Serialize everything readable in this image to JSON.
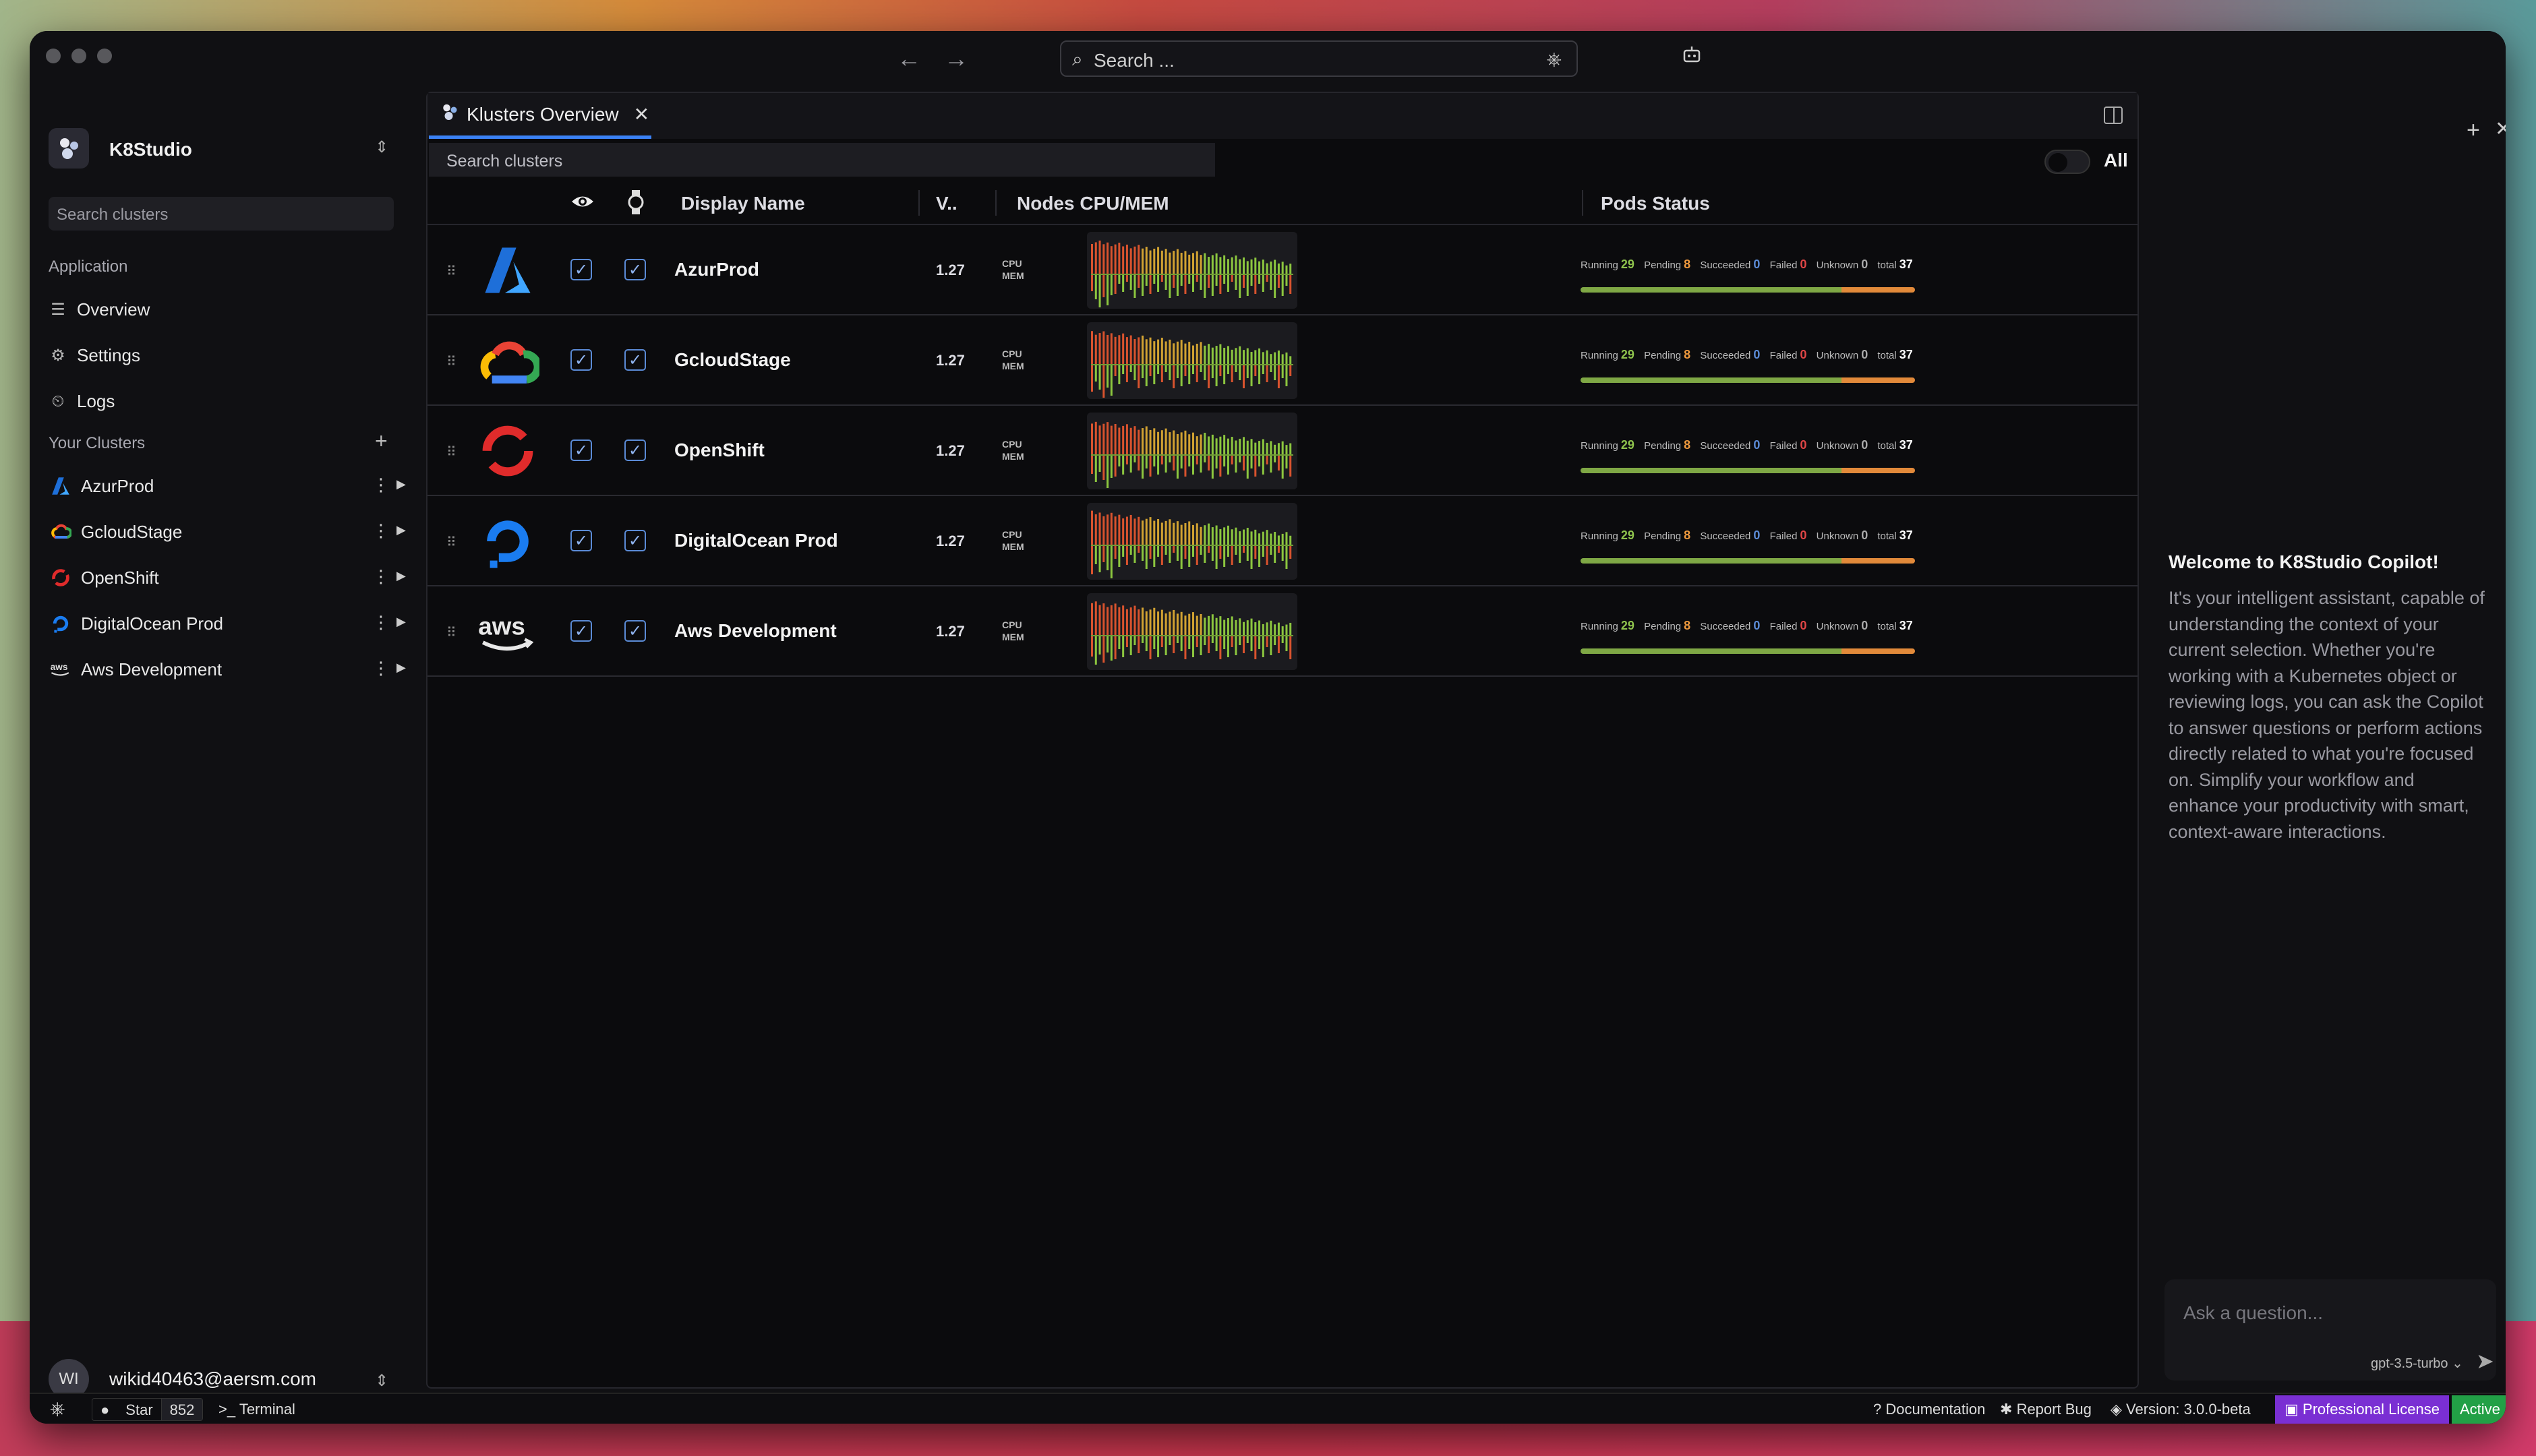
{
  "app": {
    "name": "K8Studio",
    "top_search_placeholder": "Search ..."
  },
  "sidebar": {
    "search_placeholder": "Search clusters",
    "application_label": "Application",
    "nav": [
      {
        "label": "Overview",
        "icon": "overview-icon"
      },
      {
        "label": "Settings",
        "icon": "gear-icon"
      },
      {
        "label": "Logs",
        "icon": "logs-icon"
      }
    ],
    "your_clusters_label": "Your Clusters",
    "clusters": [
      {
        "label": "AzurProd",
        "icon": "azure-icon"
      },
      {
        "label": "GcloudStage",
        "icon": "gcloud-icon"
      },
      {
        "label": "OpenShift",
        "icon": "openshift-icon"
      },
      {
        "label": "DigitalOcean Prod",
        "icon": "digitalocean-icon"
      },
      {
        "label": "Aws Development",
        "icon": "aws-icon"
      }
    ],
    "user": {
      "initials": "WI",
      "email": "wikid40463@aersm.com"
    }
  },
  "main": {
    "tab_label": "Klusters Overview",
    "search_placeholder": "Search clusters",
    "toggle_label": "All",
    "columns": {
      "display_name": "Display Name",
      "version": "V..",
      "nodes": "Nodes CPU/MEM",
      "pods": "Pods Status"
    },
    "cpu_label": "CPU",
    "mem_label": "MEM",
    "pod_labels": {
      "running": "Running",
      "pending": "Pending",
      "succeeded": "Succeeded",
      "failed": "Failed",
      "unknown": "Unknown",
      "total": "total"
    },
    "rows": [
      {
        "name": "AzurProd",
        "version": "1.27",
        "running": "29",
        "pending": "8",
        "succeeded": "0",
        "failed": "0",
        "unknown": "0",
        "total": "37"
      },
      {
        "name": "GcloudStage",
        "version": "1.27",
        "running": "29",
        "pending": "8",
        "succeeded": "0",
        "failed": "0",
        "unknown": "0",
        "total": "37"
      },
      {
        "name": "OpenShift",
        "version": "1.27",
        "running": "29",
        "pending": "8",
        "succeeded": "0",
        "failed": "0",
        "unknown": "0",
        "total": "37"
      },
      {
        "name": "DigitalOcean Prod",
        "version": "1.27",
        "running": "29",
        "pending": "8",
        "succeeded": "0",
        "failed": "0",
        "unknown": "0",
        "total": "37"
      },
      {
        "name": "Aws Development",
        "version": "1.27",
        "running": "29",
        "pending": "8",
        "succeeded": "0",
        "failed": "0",
        "unknown": "0",
        "total": "37"
      }
    ]
  },
  "copilot": {
    "title": "Welcome to K8Studio Copilot!",
    "body": "It's your intelligent assistant, capable of understanding the context of your current selection. Whether you're working with a Kubernetes object or reviewing logs, you can ask the Copilot to answer questions or perform actions directly related to what you're focused on. Simplify your workflow and enhance your productivity with smart, context-aware interactions.",
    "input_placeholder": "Ask a question...",
    "model": "gpt-3.5-turbo"
  },
  "statusbar": {
    "star_label": "Star",
    "star_count": "852",
    "terminal_label": "Terminal",
    "documentation_label": "Documentation",
    "report_bug_label": "Report Bug",
    "version_label": "Version: 3.0.0-beta",
    "license_label": "Professional License",
    "active_label": "Active"
  },
  "colors": {
    "accent": "#3b82f6",
    "running": "#7fa845",
    "pending": "#e28a3a",
    "license": "#7a2fd3",
    "active": "#22a046"
  }
}
